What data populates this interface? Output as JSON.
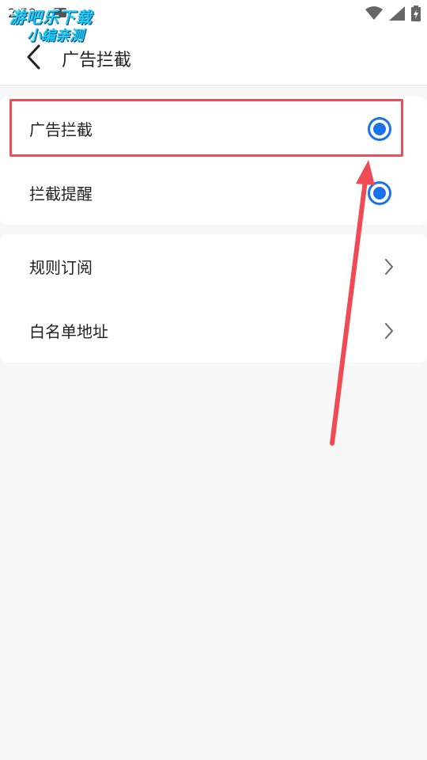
{
  "status_bar": {
    "time": "2:59",
    "icons": [
      "notification-icon",
      "wifi-icon",
      "signal-icon",
      "battery-charging-icon"
    ]
  },
  "watermark": {
    "line1": "游吧乐下载",
    "line2": "小编亲测"
  },
  "header": {
    "back_icon": "chevron-left-icon",
    "title": "广告拦截"
  },
  "settings": {
    "group1": [
      {
        "label": "广告拦截",
        "control": "radio",
        "checked": true
      },
      {
        "label": "拦截提醒",
        "control": "radio",
        "checked": true
      }
    ],
    "group2": [
      {
        "label": "规则订阅",
        "control": "chevron-right-icon"
      },
      {
        "label": "白名单地址",
        "control": "chevron-right-icon"
      }
    ]
  },
  "colors": {
    "accent": "#1a73e8",
    "annotation": "#ee4c57",
    "background": "#f7f7f7",
    "card": "#ffffff"
  }
}
